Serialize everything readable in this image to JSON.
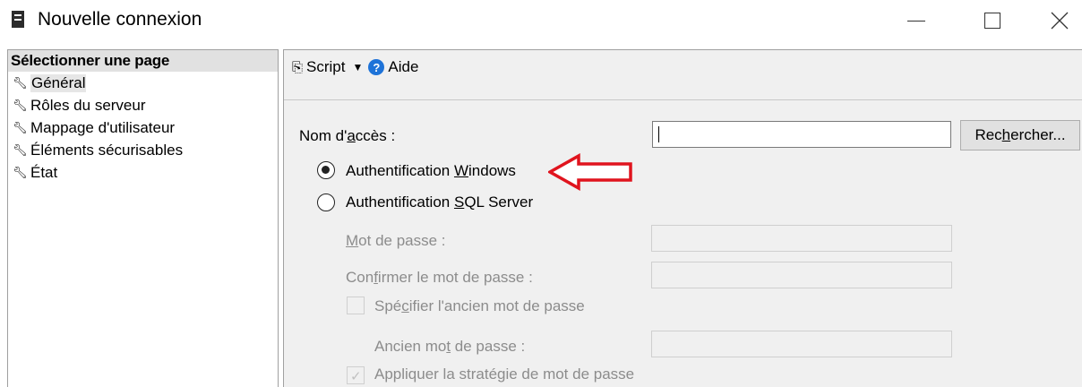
{
  "window": {
    "title": "Nouvelle connexion",
    "icon": "server-icon",
    "controls": [
      "minimize-icon",
      "maximize-icon",
      "close-icon"
    ]
  },
  "sidebar": {
    "header": "Sélectionner une page",
    "items": [
      {
        "label": "Général",
        "icon": "wrench-icon",
        "selected": true
      },
      {
        "label": "Rôles du serveur",
        "icon": "wrench-icon"
      },
      {
        "label": "Mappage d'utilisateur",
        "icon": "wrench-icon"
      },
      {
        "label": "Éléments sécurisables",
        "icon": "wrench-icon"
      },
      {
        "label": "État",
        "icon": "wrench-icon"
      }
    ]
  },
  "toolbar": {
    "script_label": "Script",
    "help_label": "Aide"
  },
  "form": {
    "login_name_label_pre": "Nom d'",
    "login_name_label_ul": "a",
    "login_name_label_post": "ccès :",
    "login_name_value": "",
    "search_button_pre": "Rec",
    "search_button_ul": "h",
    "search_button_post": "ercher...",
    "auth_windows_pre": "Authentification ",
    "auth_windows_ul": "W",
    "auth_windows_post": "indows",
    "auth_sql_pre": "Authentification ",
    "auth_sql_ul": "S",
    "auth_sql_post": "QL Server",
    "selected_auth": "windows",
    "password_label_ul": "M",
    "password_label_post": "ot de passe :",
    "confirm_password_pre": "Con",
    "confirm_password_ul": "f",
    "confirm_password_post": "irmer le mot de passe :",
    "specify_old_pre": "Spé",
    "specify_old_ul": "c",
    "specify_old_post": "ifier l'ancien mot de passe",
    "old_password_pre": "Ancien mo",
    "old_password_ul": "t",
    "old_password_post": " de passe :",
    "enforce_policy_label": "Appliquer la stratégie de mot de passe",
    "enforce_policy_checked": true
  },
  "annotation": {
    "arrow_color": "#e0141e"
  }
}
